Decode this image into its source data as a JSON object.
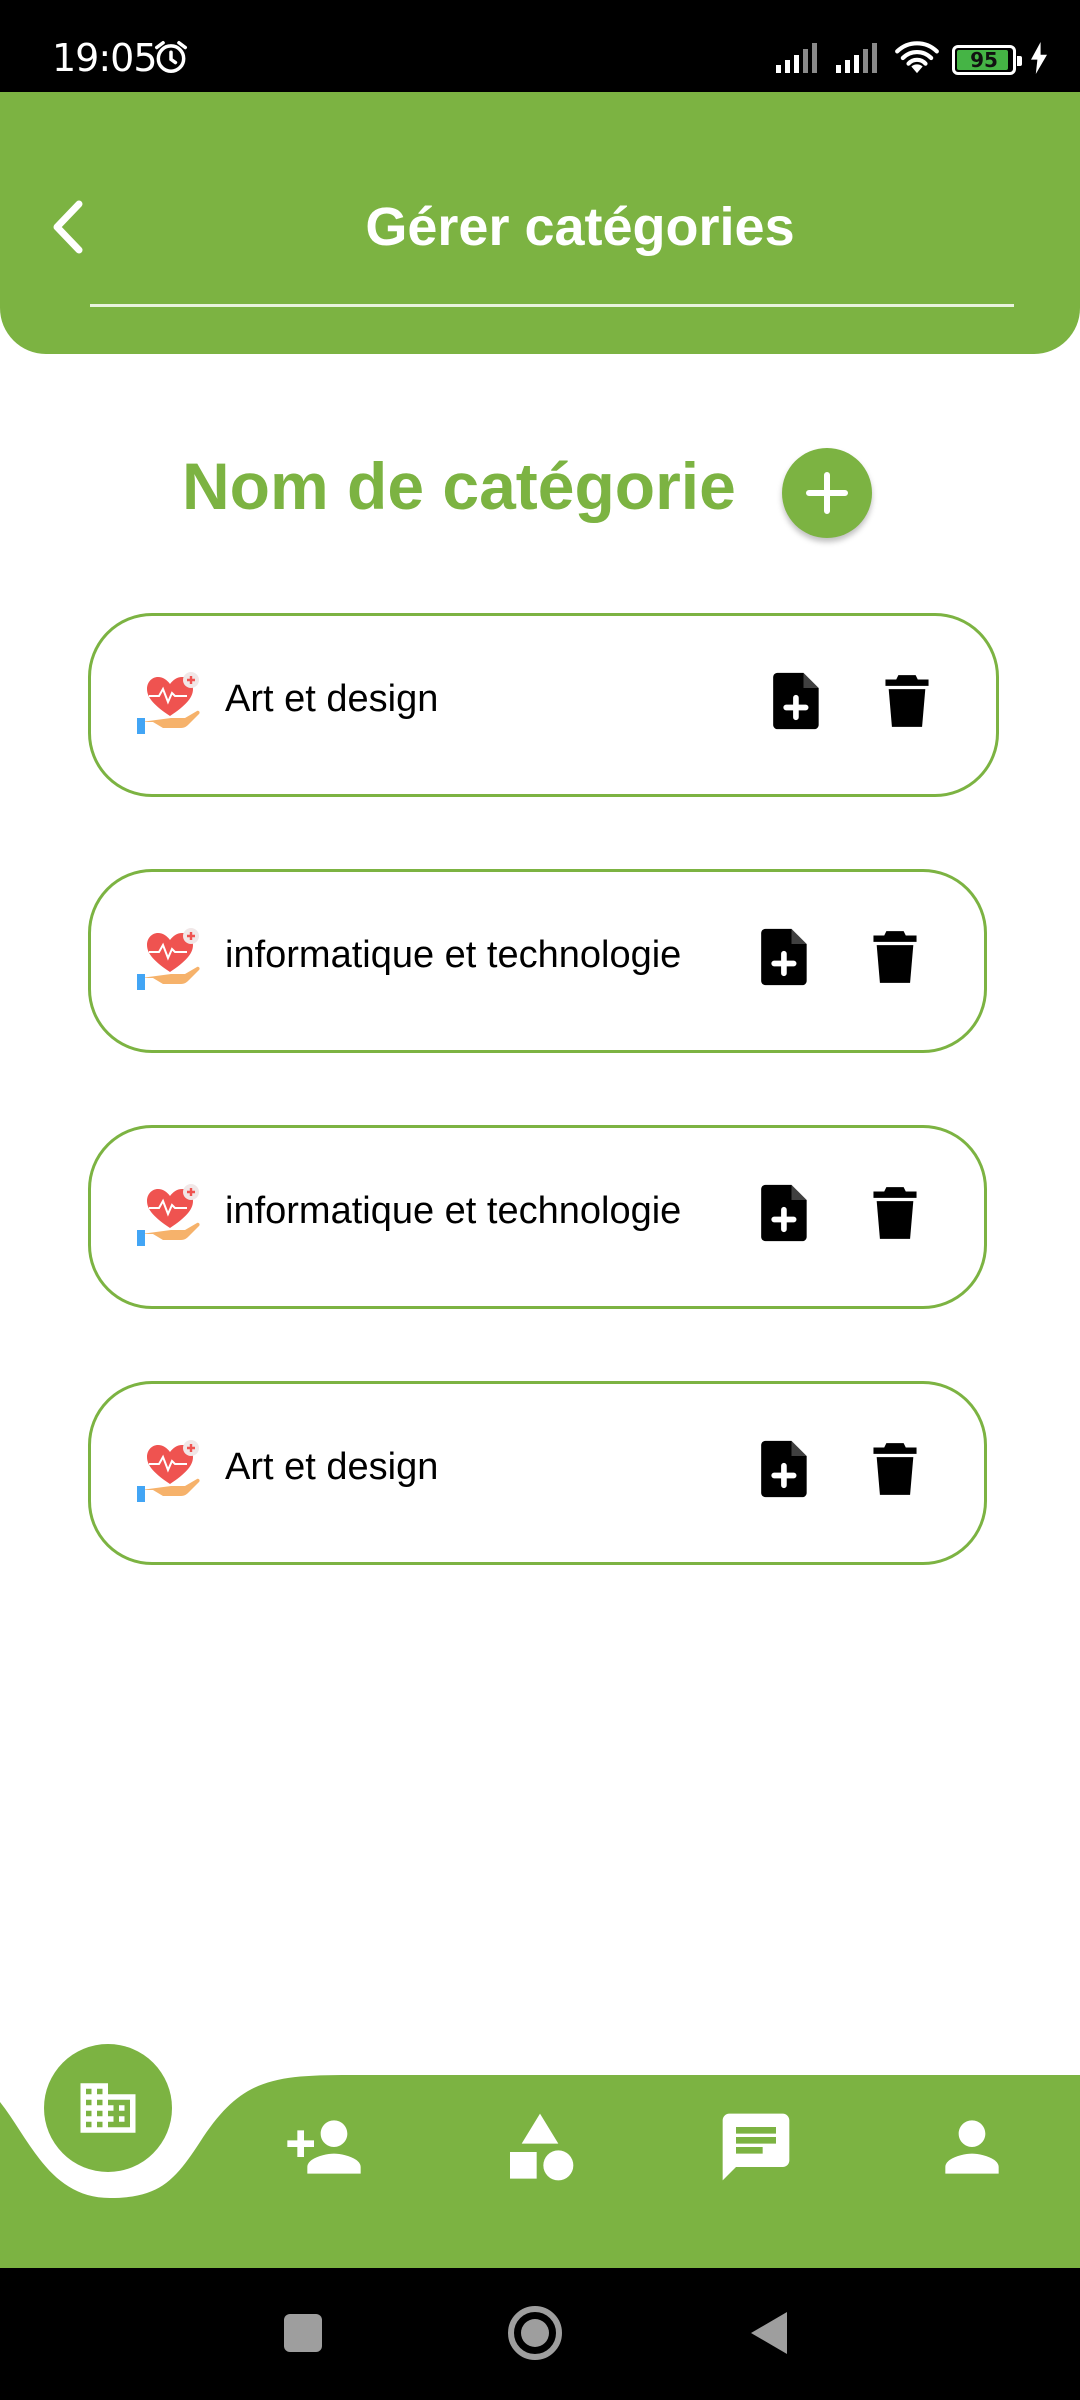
{
  "status_bar": {
    "time": "19:05",
    "battery_percent": "95",
    "battery_level": 0.95,
    "icons": [
      "alarm-icon",
      "signal-icon",
      "signal-icon",
      "wifi-icon",
      "battery-icon",
      "charging-icon"
    ]
  },
  "header": {
    "title": "Gérer catégories",
    "back_icon": "chevron-left-icon"
  },
  "main": {
    "section_title": "Nom de catégorie",
    "add_icon": "plus-icon"
  },
  "categories": [
    {
      "label": "Art et design"
    },
    {
      "label": "informatique et technologie"
    },
    {
      "label": "informatique et technologie"
    },
    {
      "label": "Art et design"
    }
  ],
  "bottom_nav": {
    "items": [
      "building-icon",
      "add-person-icon",
      "shapes-icon",
      "chat-icon",
      "person-icon"
    ]
  },
  "system_nav": {
    "items": [
      "recents-icon",
      "home-icon",
      "back-icon"
    ]
  },
  "colors": {
    "accent": "#7cb342",
    "status_bar": "#000000",
    "text": "#000000",
    "battery": "#45b445"
  }
}
